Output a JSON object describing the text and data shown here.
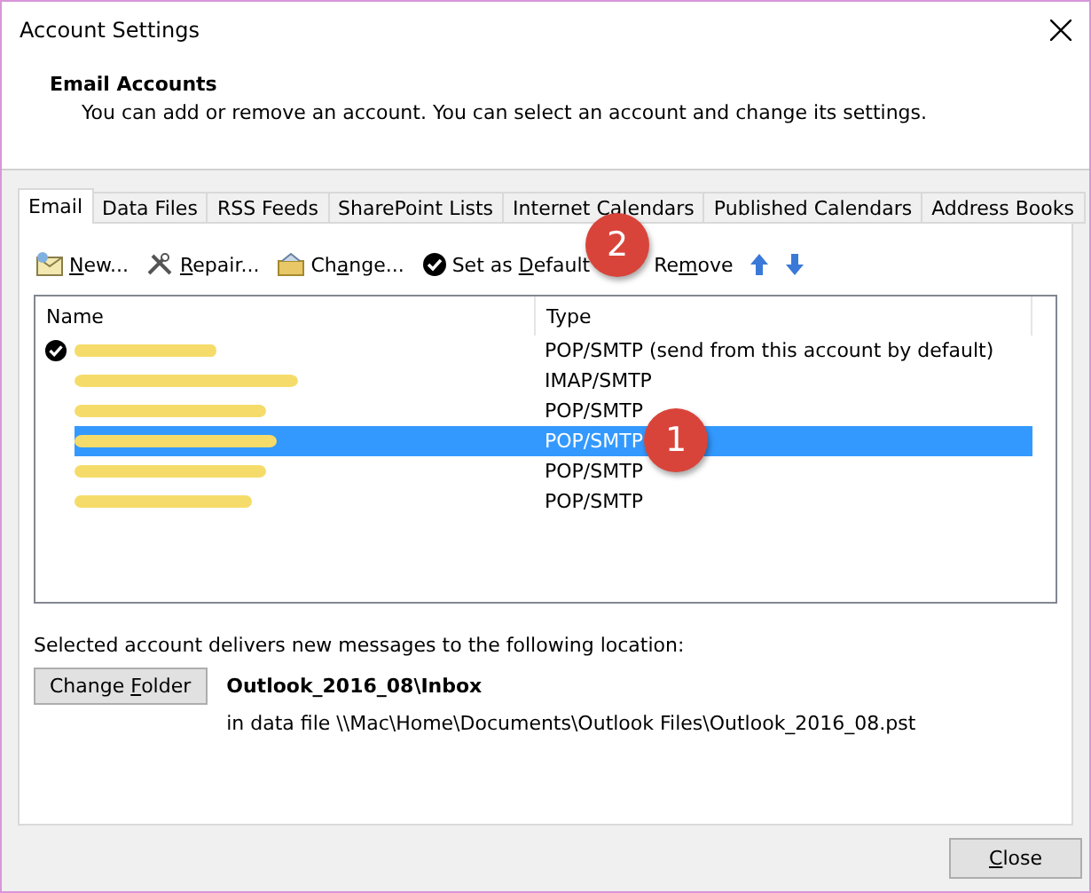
{
  "window": {
    "title": "Account Settings"
  },
  "header": {
    "title": "Email Accounts",
    "description": "You can add or remove an account. You can select an account and change its settings."
  },
  "tabs": [
    {
      "label": "Email",
      "selected": true
    },
    {
      "label": "Data Files",
      "selected": false
    },
    {
      "label": "RSS Feeds",
      "selected": false
    },
    {
      "label": "SharePoint Lists",
      "selected": false
    },
    {
      "label": "Internet Calendars",
      "selected": false
    },
    {
      "label": "Published Calendars",
      "selected": false
    },
    {
      "label": "Address Books",
      "selected": false
    }
  ],
  "toolbar": [
    {
      "kind": "new",
      "label": [
        {
          "text": "N",
          "underline": true
        },
        {
          "text": "ew...",
          "underline": false
        }
      ]
    },
    {
      "kind": "repair",
      "label": [
        {
          "text": "R",
          "underline": true
        },
        {
          "text": "epair...",
          "underline": false
        }
      ]
    },
    {
      "kind": "change",
      "label": [
        {
          "text": "Ch",
          "underline": false
        },
        {
          "text": "a",
          "underline": true
        },
        {
          "text": "nge...",
          "underline": false
        }
      ]
    },
    {
      "kind": "default",
      "label": [
        {
          "text": "Set as ",
          "underline": false
        },
        {
          "text": "D",
          "underline": true
        },
        {
          "text": "efault",
          "underline": false
        }
      ]
    },
    {
      "kind": "remove",
      "label": [
        {
          "text": "Re",
          "underline": false
        },
        {
          "text": "m",
          "underline": true
        },
        {
          "text": "ove",
          "underline": false
        }
      ]
    },
    {
      "kind": "up"
    },
    {
      "kind": "down"
    }
  ],
  "accounts": {
    "columns": [
      "Name",
      "Type"
    ],
    "rows": [
      {
        "type": "POP/SMTP (send from this account by default)",
        "default": true,
        "selected": false
      },
      {
        "type": "IMAP/SMTP",
        "default": false,
        "selected": false
      },
      {
        "type": "POP/SMTP",
        "default": false,
        "selected": false
      },
      {
        "type": "POP/SMTP",
        "default": false,
        "selected": true
      },
      {
        "type": "POP/SMTP",
        "default": false,
        "selected": false
      },
      {
        "type": "POP/SMTP",
        "default": false,
        "selected": false
      }
    ]
  },
  "location": {
    "caption": "Selected account delivers new messages to the following location:",
    "button": [
      {
        "text": "Change ",
        "underline": false
      },
      {
        "text": "F",
        "underline": true
      },
      {
        "text": "older",
        "underline": false
      }
    ],
    "folder": "Outlook_2016_08\\Inbox",
    "data_file": "in data file \\\\Mac\\Home\\Documents\\Outlook Files\\Outlook_2016_08.pst"
  },
  "close_button": [
    {
      "text": "C",
      "underline": true
    },
    {
      "text": "lose",
      "underline": false
    }
  ],
  "annotations": [
    {
      "number": "1"
    },
    {
      "number": "2"
    }
  ]
}
